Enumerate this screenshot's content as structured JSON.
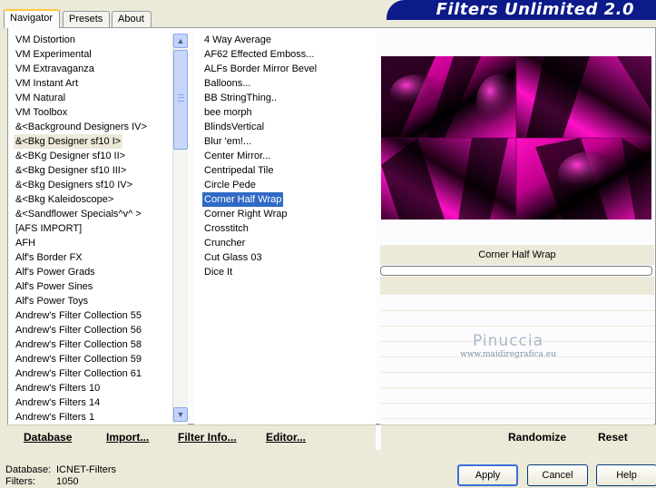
{
  "window": {
    "title": "Filters Unlimited 2.0"
  },
  "tabs": [
    {
      "label": "Navigator",
      "active": true
    },
    {
      "label": "Presets",
      "active": false
    },
    {
      "label": "About",
      "active": false
    }
  ],
  "categories": {
    "selected_index": 7,
    "items": [
      "VM Distortion",
      "VM Experimental",
      "VM Extravaganza",
      "VM Instant Art",
      "VM Natural",
      "VM Toolbox",
      "&<Background Designers IV>",
      "&<Bkg Designer sf10 I>",
      "&<BKg Designer sf10 II>",
      "&<Bkg Designer sf10 III>",
      "&<Bkg Designers sf10 IV>",
      "&<Bkg Kaleidoscope>",
      "&<Sandflower Specials^v^ >",
      "[AFS IMPORT]",
      "AFH",
      "Alf's Border FX",
      "Alf's Power Grads",
      "Alf's Power Sines",
      "Alf's Power Toys",
      "Andrew's Filter Collection 55",
      "Andrew's Filter Collection 56",
      "Andrew's Filter Collection 58",
      "Andrew's Filter Collection 59",
      "Andrew's Filter Collection 61",
      "Andrew's Filters 10",
      "Andrew's Filters 14",
      "Andrew's Filters 1"
    ]
  },
  "filters": {
    "selected_index": 11,
    "items": [
      "4 Way Average",
      "AF62 Effected Emboss...",
      "ALFs Border Mirror Bevel",
      "Balloons...",
      "BB StringThing..",
      "bee morph",
      "BlindsVertical",
      "Blur 'em!...",
      "Center Mirror...",
      "Centripedal Tile",
      "Circle Pede",
      "Corner Half Wrap",
      "Corner Right Wrap",
      "Crosstitch",
      "Cruncher",
      "Cut Glass 03",
      "Dice It"
    ]
  },
  "preview": {
    "filter_name": "Corner Half Wrap",
    "progress": 0,
    "colors": {
      "magenta": "#ff0fc4",
      "dark": "#000000",
      "mid": "#8a0060"
    }
  },
  "watermark": {
    "name": "Pinuccia",
    "url": "www.maidiregrafica.eu"
  },
  "toolbar": {
    "database": "Database",
    "import": "Import...",
    "filter_info": "Filter Info...",
    "editor": "Editor...",
    "randomize": "Randomize",
    "reset": "Reset"
  },
  "status": {
    "database_label": "Database:",
    "database_value": "ICNET-Filters",
    "filters_label": "Filters:",
    "filters_value": "1050"
  },
  "buttons": {
    "apply": "Apply",
    "cancel": "Cancel",
    "help": "Help"
  },
  "icons": {
    "scroll_up": "▲",
    "scroll_down": "▼"
  }
}
